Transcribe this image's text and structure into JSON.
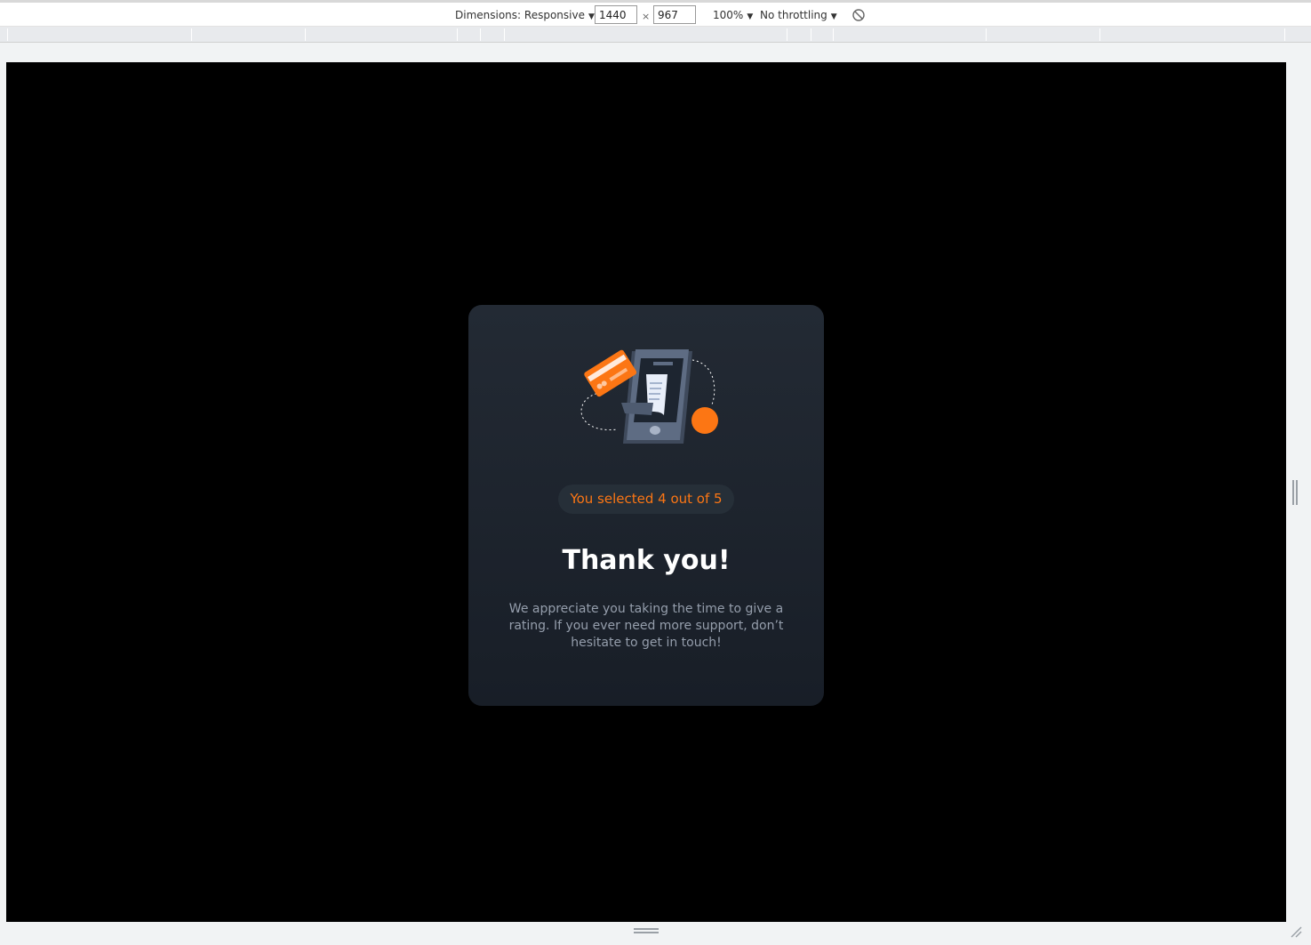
{
  "devtools": {
    "dimensions_label": "Dimensions: Responsive",
    "width_value": "1440",
    "times": "×",
    "height_value": "967",
    "zoom_label": "100%",
    "throttling_label": "No throttling",
    "rotate_icon": "rotate-icon"
  },
  "card": {
    "illustration_icon": "phone-payment-illustration",
    "badge_text": "You selected 4 out of 5",
    "title": "Thank you!",
    "body": "We appreciate you taking the time to give a rating. If you ever need more support, don’t hesitate to get in touch!"
  },
  "colors": {
    "accent": "#fc7614",
    "card_top": "#232a34",
    "card_bottom": "#181e27",
    "body_text": "#959eac",
    "background": "#000000"
  }
}
